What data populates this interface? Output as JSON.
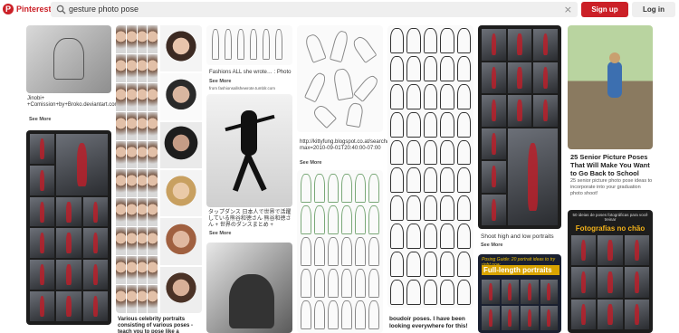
{
  "header": {
    "brand": "Pinterest",
    "search_value": "gesture photo pose",
    "clear_label": "×",
    "signup_label": "Sign up",
    "login_label": "Log in",
    "logo_letter": "P"
  },
  "pins": {
    "p1_caption": "Jinobi+ +Comission+by+Broko.deviantart.com+on+@deviantART",
    "p3_caption": "Fashions ALL she wrote… : Photo",
    "p3_more": "See More",
    "p3_source": "from fashionsallshewrote.tumblr.com",
    "p4_caption": "タップダンス 日本人で世界で活躍している熊谷和徳さん 熊谷和徳さん + 世界のダンスまとめ +",
    "p5_caption": "http://kittyfung.blogspot.co.at/search/updated-max=2010-09-01T20:40:00-07:00",
    "p6_caption": "Shoot high and low portraits",
    "p7_caption": "25 Senior Picture Poses That Will Make You Want to Go Back to School",
    "p7_sub": "25 senior picture photo pose ideas to incorporate into your graduation photo shoot!",
    "p8_caption": "Various celebrity portraits consisting of various poses - teach you to pose like a professional",
    "p9_caption": "boudoir poses. I have been looking everywhere for this!",
    "p10_title": "Full-length portraits",
    "p10_kicker": "Posing Guide: 20 portrait ideas to try right now",
    "p11_title": "Fotografias no chão",
    "p11_kicker": "50 ideias de poses fotográficas para você treinar",
    "see_more": "See More"
  },
  "colors": {
    "brand": "#cb2027",
    "search_bg": "#efefef"
  }
}
